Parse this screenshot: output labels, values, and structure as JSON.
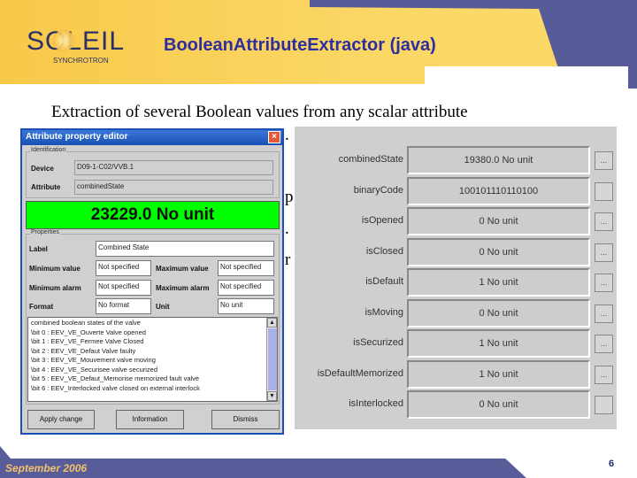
{
  "header": {
    "logo_name": "SOLEIL",
    "logo_sub": "SYNCHROTRON",
    "title": "BooleanAttributeExtractor (java)"
  },
  "intro": "Extraction of several Boolean values from any scalar attribute",
  "intro_fragments": [
    ".",
    "p",
    ".",
    "r"
  ],
  "dialog": {
    "title": "Attribute property editor",
    "close": "×",
    "identification_label": "Identification",
    "device_label": "Device",
    "device_value": "D09-1-C02/VVB.1",
    "attribute_label": "Attribute",
    "attribute_value": "combinedState",
    "value_display": "23229.0 No unit",
    "properties_label": "Properties",
    "label_label": "Label",
    "label_value": "Combined State",
    "min_value_label": "Minimum value",
    "min_value": "Not specified",
    "max_value_label": "Maximum value",
    "max_value": "Not specified",
    "min_alarm_label": "Minimum alarm",
    "min_alarm": "Not specified",
    "max_alarm_label": "Maximum alarm",
    "max_alarm": "Not specified",
    "format_label": "Format",
    "format_value": "No format",
    "unit_label": "Unit",
    "unit_value": "No unit",
    "description": [
      "combined boolean states of the valve",
      "\\bit 0 : EEV_VE_Ouverte Valve opened",
      "\\bit 1 : EEV_VE_Fermee Valve Closed",
      "\\bit 2 : EEV_VE_Defaut Valve faulty",
      "\\bit 3 : EEV_VE_Mouvement valve moving",
      "\\bit 4 : EEV_VE_Securisee valve securized",
      "\\bit 5 : EEV_VE_Defaut_Memorise memorized fault valve",
      "\\bit 6 : EEV_Interlocked valve closed on external interlock"
    ],
    "buttons": {
      "apply": "Apply change",
      "information": "Information",
      "dismiss": "Dismiss"
    }
  },
  "panel": {
    "rows": [
      {
        "label": "combinedState",
        "value": "19380.0 No unit",
        "button": "..."
      },
      {
        "label": "binaryCode",
        "value": "100101110110100",
        "button": ""
      },
      {
        "label": "isOpened",
        "value": "0 No unit",
        "button": "..."
      },
      {
        "label": "isClosed",
        "value": "0 No unit",
        "button": "..."
      },
      {
        "label": "isDefault",
        "value": "1 No unit",
        "button": "..."
      },
      {
        "label": "isMoving",
        "value": "0 No unit",
        "button": "..."
      },
      {
        "label": "isSecurized",
        "value": "1 No unit",
        "button": "..."
      },
      {
        "label": "isDefaultMemorized",
        "value": "1 No unit",
        "button": "..."
      },
      {
        "label": "isInterlocked",
        "value": "0 No unit",
        "button": ""
      }
    ]
  },
  "footer": {
    "date": "September 2006",
    "page": "6"
  }
}
